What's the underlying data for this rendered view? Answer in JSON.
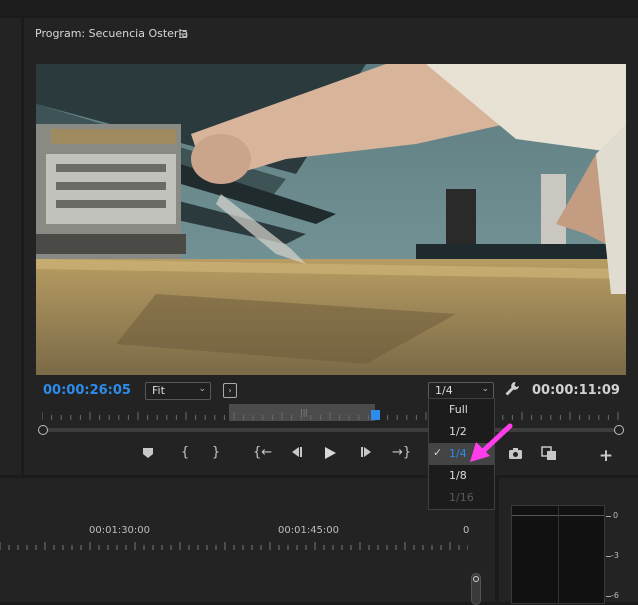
{
  "program_monitor": {
    "title": "Program: Secuencia Osteria",
    "menu_icon": "hamburger-menu-icon",
    "current_timecode": "00:00:26:05",
    "duration_timecode": "00:00:11:09",
    "zoom_select": {
      "value": "Fit",
      "icon": "chevron-down-icon"
    },
    "resolution_select": {
      "value": "1/4",
      "options": [
        {
          "label": "Full",
          "selected": false,
          "disabled": false
        },
        {
          "label": "1/2",
          "selected": false,
          "disabled": false
        },
        {
          "label": "1/4",
          "selected": true,
          "disabled": false
        },
        {
          "label": "1/8",
          "selected": false,
          "disabled": false
        },
        {
          "label": "1/16",
          "selected": false,
          "disabled": true
        }
      ]
    },
    "transport": [
      {
        "name": "add-marker-button",
        "icon": "marker-icon"
      },
      {
        "name": "mark-in-button",
        "icon": "mark-in-icon"
      },
      {
        "name": "mark-out-button",
        "icon": "mark-out-icon"
      },
      {
        "name": "go-to-in-button",
        "icon": "go-to-in-icon"
      },
      {
        "name": "step-back-button",
        "icon": "step-back-icon"
      },
      {
        "name": "play-button",
        "icon": "play-icon"
      },
      {
        "name": "step-forward-button",
        "icon": "step-forward-icon"
      },
      {
        "name": "go-to-out-button",
        "icon": "go-to-out-icon"
      },
      {
        "name": "export-frame-button",
        "icon": "camera-icon"
      },
      {
        "name": "compare-view-button",
        "icon": "compare-icon"
      },
      {
        "name": "button-editor-button",
        "icon": "plus-icon"
      }
    ],
    "accent_color": "#2d8ceb",
    "annotation_arrow_color": "#ff3dea"
  },
  "timeline": {
    "ruler_labels": [
      "00:01:30:00",
      "00:01:45:00",
      "0"
    ]
  },
  "audio_meter": {
    "db_labels": [
      "0",
      "-3",
      "-6"
    ]
  }
}
